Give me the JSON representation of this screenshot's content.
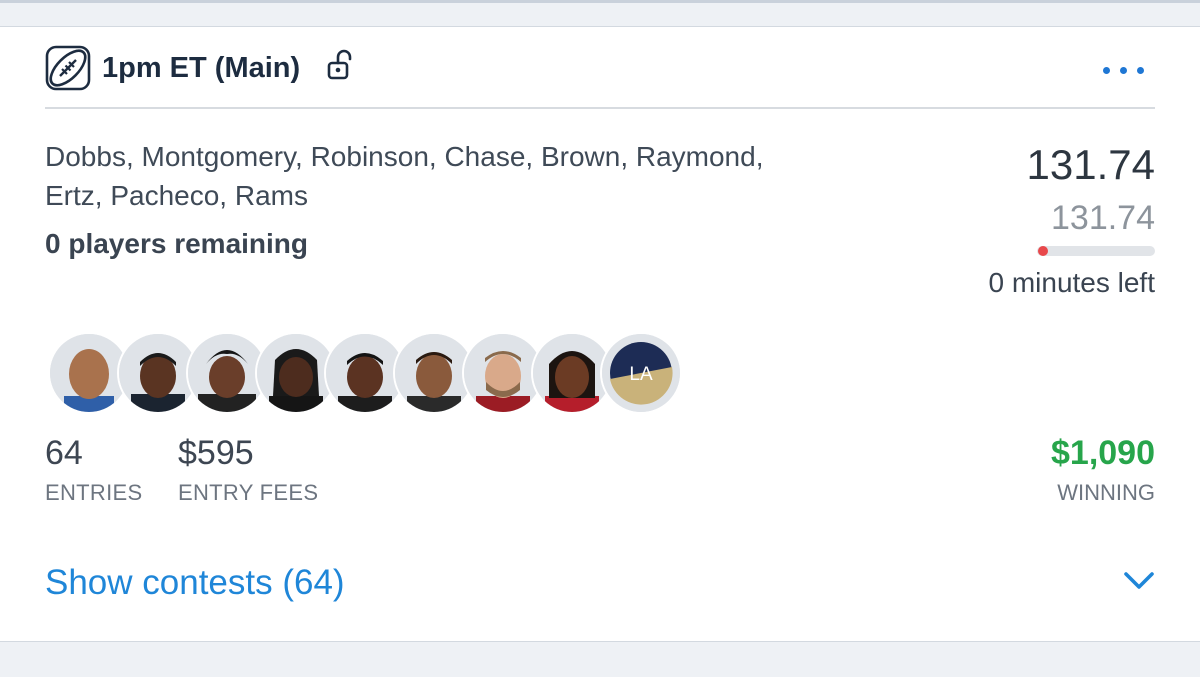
{
  "header": {
    "slate_title": "1pm ET (Main)",
    "sport_icon": "football-icon",
    "lock_icon": "unlock-icon",
    "more_icon": "more-dots-icon"
  },
  "lineup": {
    "names_line1": "Dobbs, Montgomery, Robinson, Chase, Brown, Raymond,",
    "names_line2": "Ertz, Pacheco, Rams",
    "players_remaining": "0 players remaining"
  },
  "score": {
    "points": "131.74",
    "projected": "131.74",
    "progress_fraction": 0.0,
    "time_left": "0 minutes left"
  },
  "avatars": {
    "players": [
      "Dobbs",
      "Montgomery",
      "Robinson",
      "Chase",
      "Brown",
      "Raymond",
      "Ertz",
      "Pacheco"
    ],
    "team_logo_text": "LA"
  },
  "stats": {
    "entries_value": "64",
    "entries_label": "ENTRIES",
    "fees_value": "$595",
    "fees_label": "ENTRY FEES",
    "winning_value": "$1,090",
    "winning_label": "WINNING"
  },
  "footer": {
    "show_contests": "Show contests (64)",
    "chevron_icon": "chevron-down-icon"
  },
  "colors": {
    "accent_blue": "#1f86d8",
    "winning_green": "#27a54b",
    "progress_red": "#e8484b"
  }
}
